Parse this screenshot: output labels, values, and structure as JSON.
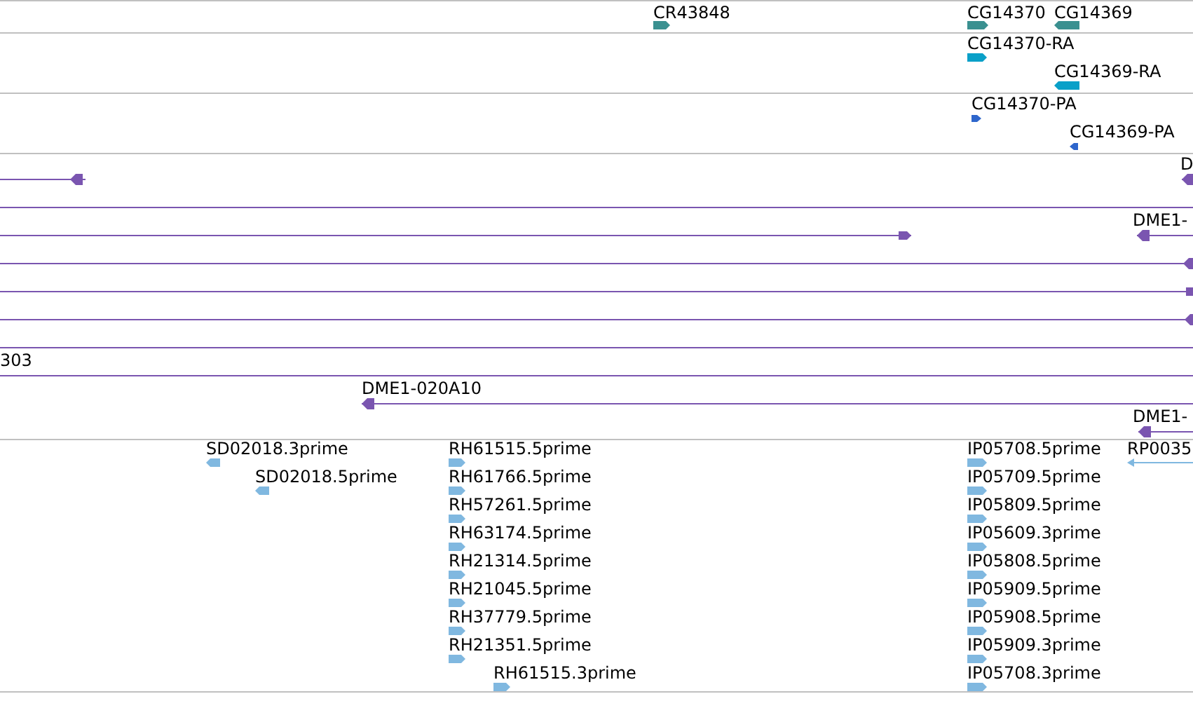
{
  "tracks": [
    {
      "kind": "gene",
      "color": "#3a9090",
      "features": [
        {
          "label": "CR43848",
          "reverse": false
        },
        {
          "label": "CG14370",
          "reverse": false
        },
        {
          "label": "CG14369",
          "reverse": true
        }
      ]
    },
    {
      "kind": "transcript",
      "color": "#0aa0c8",
      "features": [
        {
          "label": "CG14370-RA",
          "reverse": false
        },
        {
          "label": "CG14369-RA",
          "reverse": true
        }
      ]
    },
    {
      "kind": "protein",
      "color": "#2e66cc",
      "features": [
        {
          "label": "CG14370-PA",
          "reverse": false
        },
        {
          "label": "CG14369-PA",
          "reverse": true
        }
      ]
    },
    {
      "kind": "clone",
      "color": "#7a55b0",
      "features": [
        {
          "kind": "arrow",
          "reverse": true
        },
        {
          "kind": "arrow",
          "label": "D",
          "reverse": true
        },
        {
          "kind": "line"
        },
        {
          "kind": "arrow",
          "reverse": false
        },
        {
          "kind": "arrow",
          "label": "DME1-",
          "reverse": true
        },
        {
          "kind": "arrow",
          "reverse": true
        },
        {
          "kind": "arrow",
          "reverse": false
        },
        {
          "kind": "arrow",
          "reverse": true
        },
        {
          "kind": "line"
        },
        {
          "kind": "line",
          "label": "303"
        },
        {
          "kind": "arrow",
          "label": "DME1-020A10",
          "reverse": true
        },
        {
          "kind": "arrow",
          "label": "DME1-",
          "reverse": true
        }
      ]
    },
    {
      "kind": "est",
      "color": "#80b8e0",
      "features": [
        {
          "label": "SD02018.3prime",
          "reverse": true
        },
        {
          "label": "SD02018.5prime",
          "reverse": true
        },
        {
          "label": "RH61515.5prime",
          "reverse": false
        },
        {
          "label": "RH61766.5prime",
          "reverse": false
        },
        {
          "label": "RH57261.5prime",
          "reverse": false
        },
        {
          "label": "RH63174.5prime",
          "reverse": false
        },
        {
          "label": "RH21314.5prime",
          "reverse": false
        },
        {
          "label": "RH21045.5prime",
          "reverse": false
        },
        {
          "label": "RH37779.5prime",
          "reverse": false
        },
        {
          "label": "RH21351.5prime",
          "reverse": false
        },
        {
          "label": "RH61515.3prime",
          "reverse": false
        },
        {
          "label": "IP05708.5prime",
          "reverse": false
        },
        {
          "label": "IP05709.5prime",
          "reverse": false
        },
        {
          "label": "IP05809.5prime",
          "reverse": false
        },
        {
          "label": "IP05609.3prime",
          "reverse": false
        },
        {
          "label": "IP05808.5prime",
          "reverse": false
        },
        {
          "label": "IP05909.5prime",
          "reverse": false
        },
        {
          "label": "IP05908.5prime",
          "reverse": false
        },
        {
          "label": "IP05909.3prime",
          "reverse": false
        },
        {
          "label": "IP05708.3prime",
          "reverse": false
        },
        {
          "label": "RP0035",
          "reverse": true
        }
      ]
    }
  ]
}
